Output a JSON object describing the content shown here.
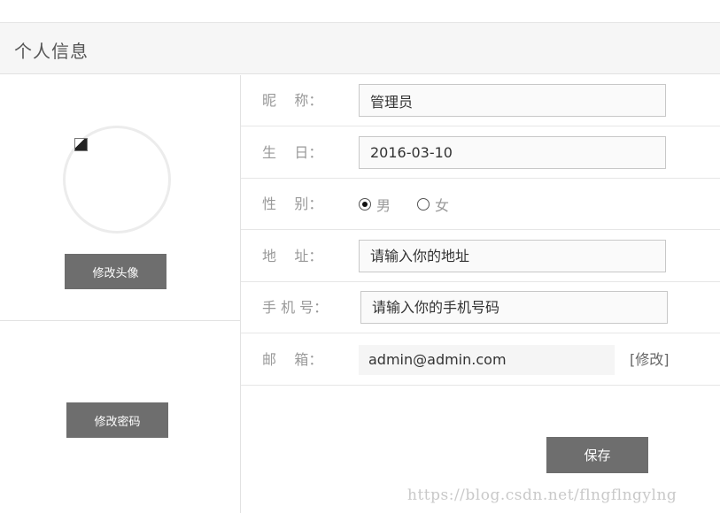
{
  "header": {
    "title": "个人信息"
  },
  "left_panel": {
    "change_avatar_label": "修改头像",
    "change_password_label": "修改密码"
  },
  "form": {
    "nickname": {
      "label": "昵    称：",
      "value": "管理员"
    },
    "birthday": {
      "label": "生    日：",
      "value": "2016-03-10"
    },
    "gender": {
      "label": "性    别：",
      "options": [
        {
          "label": "男",
          "checked": true
        },
        {
          "label": "女",
          "checked": false
        }
      ]
    },
    "address": {
      "label": "地    址：",
      "placeholder": "请输入你的地址"
    },
    "phone": {
      "label": "手 机 号：",
      "placeholder": "请输入你的手机号码"
    },
    "email": {
      "label": "邮    箱：",
      "value": "admin@admin.com",
      "modify_label": "[修改]"
    }
  },
  "save_label": "保存",
  "watermark": "https://blog.csdn.net/flngflngylng",
  "colors": {
    "button_bg": "#6e6e6e",
    "header_bg": "#f6f6f6",
    "label_text": "#999999"
  }
}
